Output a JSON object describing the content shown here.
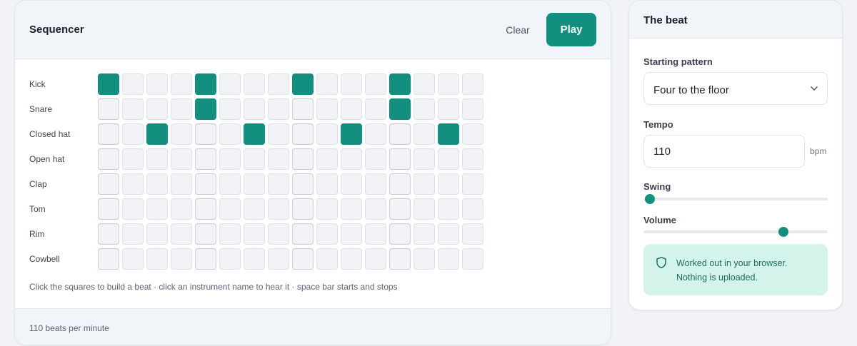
{
  "sequencer": {
    "title": "Sequencer",
    "clear_label": "Clear",
    "play_label": "Play",
    "instruments": [
      {
        "name": "Kick",
        "steps": [
          1,
          0,
          0,
          0,
          1,
          0,
          0,
          0,
          1,
          0,
          0,
          0,
          1,
          0,
          0,
          0
        ]
      },
      {
        "name": "Snare",
        "steps": [
          0,
          0,
          0,
          0,
          1,
          0,
          0,
          0,
          0,
          0,
          0,
          0,
          1,
          0,
          0,
          0
        ]
      },
      {
        "name": "Closed hat",
        "steps": [
          0,
          0,
          1,
          0,
          0,
          0,
          1,
          0,
          0,
          0,
          1,
          0,
          0,
          0,
          1,
          0
        ]
      },
      {
        "name": "Open hat",
        "steps": [
          0,
          0,
          0,
          0,
          0,
          0,
          0,
          0,
          0,
          0,
          0,
          0,
          0,
          0,
          0,
          0
        ]
      },
      {
        "name": "Clap",
        "steps": [
          0,
          0,
          0,
          0,
          0,
          0,
          0,
          0,
          0,
          0,
          0,
          0,
          0,
          0,
          0,
          0
        ]
      },
      {
        "name": "Tom",
        "steps": [
          0,
          0,
          0,
          0,
          0,
          0,
          0,
          0,
          0,
          0,
          0,
          0,
          0,
          0,
          0,
          0
        ]
      },
      {
        "name": "Rim",
        "steps": [
          0,
          0,
          0,
          0,
          0,
          0,
          0,
          0,
          0,
          0,
          0,
          0,
          0,
          0,
          0,
          0
        ]
      },
      {
        "name": "Cowbell",
        "steps": [
          0,
          0,
          0,
          0,
          0,
          0,
          0,
          0,
          0,
          0,
          0,
          0,
          0,
          0,
          0,
          0
        ]
      }
    ],
    "hint": "Click the squares to build a beat · click an instrument name to hear it · space bar starts and stops",
    "footer": "110 beats per minute"
  },
  "beat_panel": {
    "title": "The beat",
    "pattern_label": "Starting pattern",
    "pattern_value": "Four to the floor",
    "tempo_label": "Tempo",
    "tempo_value": "110",
    "tempo_unit": "bpm",
    "swing_label": "Swing",
    "swing_level": 0.0,
    "volume_label": "Volume",
    "volume_level": 0.78,
    "notice_line1": "Worked out in your browser.",
    "notice_line2": "Nothing is uploaded.",
    "notice_icon": "shield-icon"
  },
  "colors": {
    "accent": "#138f80",
    "notice_bg": "#d4f3ea",
    "notice_text": "#1d6d5f"
  }
}
